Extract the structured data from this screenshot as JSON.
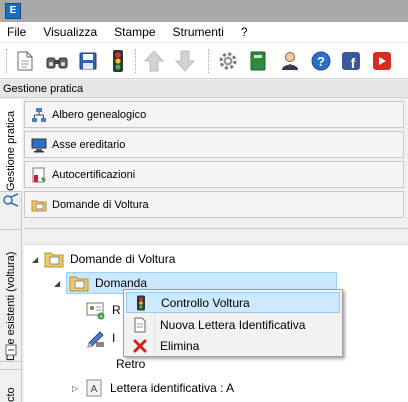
{
  "app": {
    "icon_letter": "E"
  },
  "menubar": {
    "items": [
      "File",
      "Visualizza",
      "Stampe",
      "Strumenti",
      "?"
    ]
  },
  "toolbar": {
    "icons": [
      "new-document-icon",
      "find-icon",
      "save-icon",
      "traffic-light-icon",
      "arrow-up-icon",
      "arrow-down-icon",
      "gear-icon",
      "book-icon",
      "user-icon",
      "help-icon",
      "facebook-icon",
      "youtube-icon"
    ]
  },
  "section": {
    "label": "Gestione pratica"
  },
  "vtabs": {
    "gestione": "Gestione pratica",
    "ditte": "Ditte esistenti (voltura)",
    "bottom": "cto"
  },
  "panels": [
    {
      "label": "Albero genealogico",
      "icon": "family-tree-icon"
    },
    {
      "label": "Asse ereditario",
      "icon": "computer-icon"
    },
    {
      "label": "Autocertificazioni",
      "icon": "certificate-icon"
    },
    {
      "label": "Domande di Voltura",
      "icon": "folder-icon"
    }
  ],
  "tree": {
    "root": "Domande di Voltura",
    "selected": "Domanda",
    "child_r": "R",
    "child_i": "I",
    "child_retro": "Retro",
    "lettera": "Lettera identificativa : A"
  },
  "context_menu": {
    "items": [
      {
        "label": "Controllo Voltura",
        "icon": "traffic-light-icon"
      },
      {
        "label": "Nuova Lettera Identificativa",
        "icon": "document-icon"
      },
      {
        "label": "Elimina",
        "icon": "delete-icon"
      }
    ]
  },
  "colors": {
    "selection": "#cce8ff",
    "accent": "#1b6fbd"
  }
}
